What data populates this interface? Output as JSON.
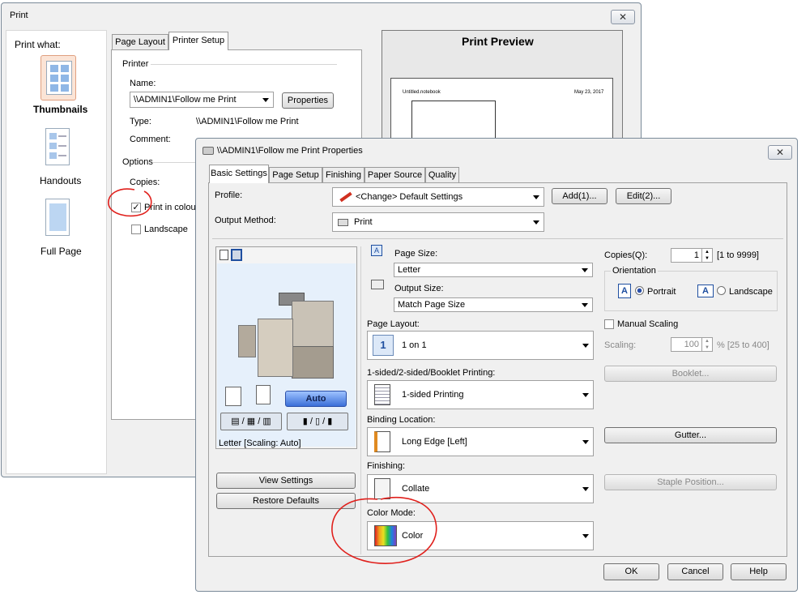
{
  "print_dialog": {
    "title": "Print",
    "print_what_label": "Print what:",
    "thumbnails_label": "Thumbnails",
    "handouts_label": "Handouts",
    "full_page_label": "Full Page",
    "tabs": [
      "Page Layout",
      "Printer Setup"
    ],
    "printer_group": "Printer",
    "name_label": "Name:",
    "printer_name": "\\\\ADMIN1\\Follow me Print",
    "properties_button": "Properties",
    "type_label": "Type:",
    "type_value": "\\\\ADMIN1\\Follow me Print",
    "comment_label": "Comment:",
    "options_group": "Options",
    "copies_label": "Copies:",
    "print_in_colour": "Print in colour",
    "landscape": "Landscape",
    "preview_title": "Print Preview",
    "preview_doc_name": "Untitled.notebook",
    "preview_date": "May 23, 2017"
  },
  "props_dialog": {
    "title": "\\\\ADMIN1\\Follow me Print Properties",
    "tabs": [
      "Basic Settings",
      "Page Setup",
      "Finishing",
      "Paper Source",
      "Quality"
    ],
    "profile_label": "Profile:",
    "profile_value": "<Change> Default Settings",
    "add_button": "Add(1)...",
    "edit_button": "Edit(2)...",
    "output_method_label": "Output Method:",
    "output_method_value": "Print",
    "preview_caption": "Letter [Scaling: Auto]",
    "auto_button": "Auto",
    "view_settings_button": "View Settings",
    "restore_defaults_button": "Restore Defaults",
    "page_size_label": "Page Size:",
    "page_size_value": "Letter",
    "output_size_label": "Output Size:",
    "output_size_value": "Match Page Size",
    "page_layout_label": "Page Layout:",
    "page_layout_icon_text": "1",
    "page_layout_value": "1 on 1",
    "sided_label": "1-sided/2-sided/Booklet Printing:",
    "sided_value": "1-sided Printing",
    "binding_label": "Binding Location:",
    "binding_value": "Long Edge [Left]",
    "finishing_label": "Finishing:",
    "finishing_value": "Collate",
    "color_mode_label": "Color Mode:",
    "color_mode_value": "Color",
    "copies_label": "Copies(Q):",
    "copies_value": "1",
    "copies_range": "[1 to 9999]",
    "orientation_label": "Orientation",
    "portrait_label": "Portrait",
    "landscape_label": "Landscape",
    "orientation_icon_letter": "A",
    "manual_scaling_label": "Manual Scaling",
    "scaling_label": "Scaling:",
    "scaling_value": "100",
    "scaling_range": "% [25 to 400]",
    "booklet_button": "Booklet...",
    "gutter_button": "Gutter...",
    "staple_button": "Staple Position...",
    "ok_button": "OK",
    "cancel_button": "Cancel",
    "help_button": "Help"
  },
  "colors": {
    "annotation_red": "#e0201c",
    "auto_blue": "#3a6fd8",
    "link_blue": "#1f4fa0"
  }
}
